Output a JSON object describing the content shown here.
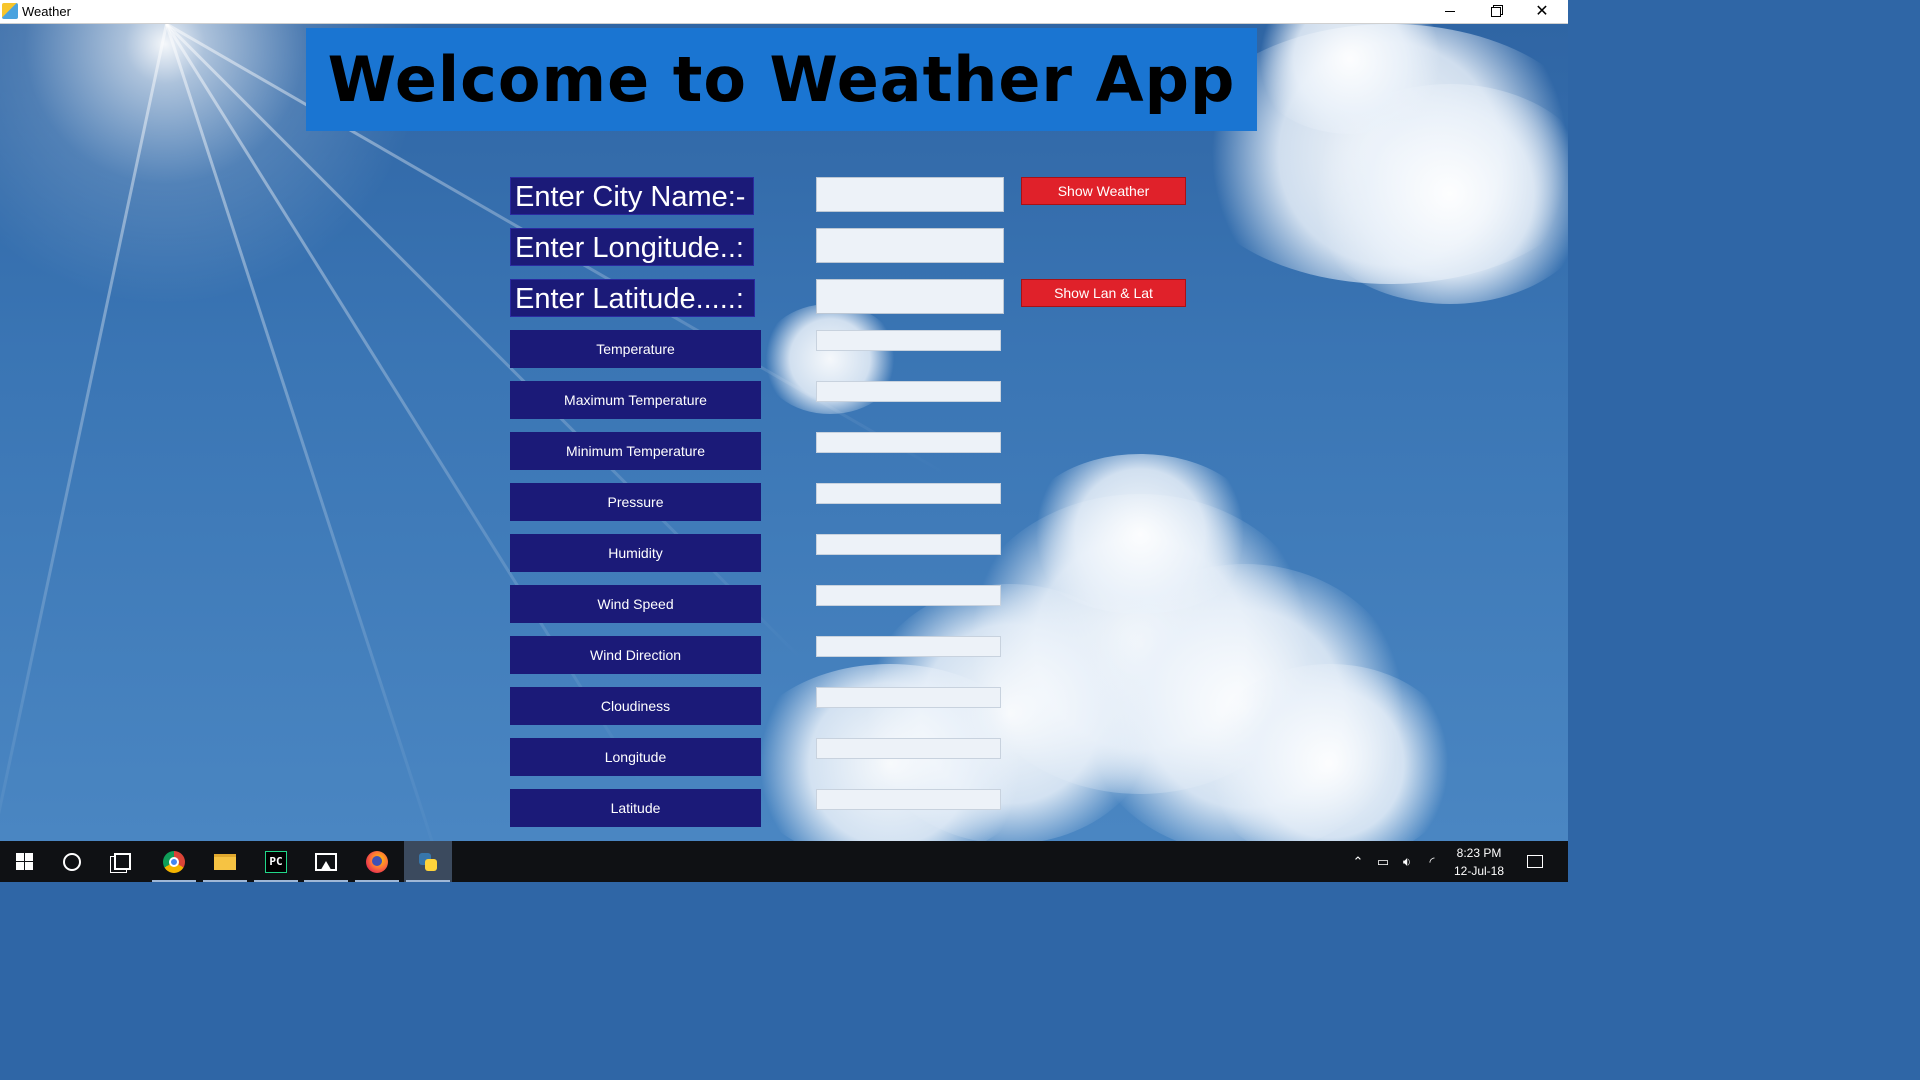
{
  "window": {
    "title": "Weather"
  },
  "banner": {
    "title": "Welcome to Weather App"
  },
  "inputs": {
    "city_label": "Enter City Name:-",
    "longitude_label": "Enter Longitude..:",
    "latitude_label": "Enter Latitude.....:",
    "city_value": "",
    "longitude_value": "",
    "latitude_value": ""
  },
  "buttons": {
    "show_weather": "Show Weather",
    "show_lan_lat": "Show Lan & Lat"
  },
  "fields": [
    {
      "label": "Temperature",
      "value": ""
    },
    {
      "label": "Maximum Temperature",
      "value": ""
    },
    {
      "label": "Minimum Temperature",
      "value": ""
    },
    {
      "label": "Pressure",
      "value": ""
    },
    {
      "label": "Humidity",
      "value": ""
    },
    {
      "label": "Wind Speed",
      "value": ""
    },
    {
      "label": "Wind Direction",
      "value": ""
    },
    {
      "label": "Cloudiness",
      "value": ""
    },
    {
      "label": "Longitude",
      "value": ""
    },
    {
      "label": "Latitude",
      "value": ""
    }
  ],
  "taskbar": {
    "apps": [
      "start-icon",
      "cortana-icon",
      "task-view-icon",
      "chrome-icon",
      "file-explorer-icon",
      "pycharm-icon",
      "photos-icon",
      "firefox-icon",
      "python-icon"
    ],
    "pycharm_glyph": "PC",
    "clock_time": "8:23 PM",
    "clock_date": "12-Jul-18"
  },
  "colors": {
    "banner": "#1a75d2",
    "label_bg": "#1b1a78",
    "button_red": "#e0212a"
  }
}
